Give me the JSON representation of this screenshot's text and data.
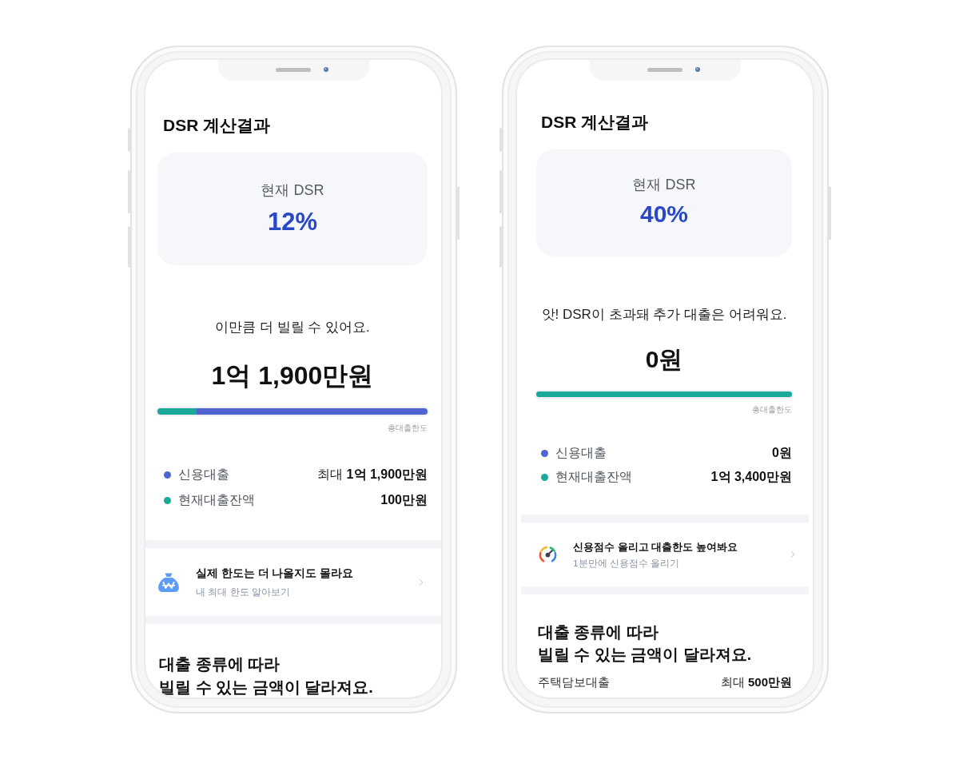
{
  "phones": [
    {
      "title": "DSR 계산결과",
      "dsr": {
        "label": "현재 DSR",
        "value": "12%"
      },
      "message": "이만큼 더 빌릴 수 있어요.",
      "amount": "1억 1,900만원",
      "bar": {
        "segments": [
          {
            "color": "#1aa89b",
            "level": 0.145
          },
          {
            "color": "#4f63d3",
            "level": 0.855
          }
        ],
        "caption": "총대출한도"
      },
      "legend": [
        {
          "label": "신용대출",
          "color": "#4f63d3",
          "prefix": "최대",
          "value": "1억 1,900만원"
        },
        {
          "label": "현재대출잔액",
          "color": "#1aa89b",
          "value": "100만원"
        }
      ],
      "promo": {
        "kind": "limit",
        "title": "실제 한도는 더 나올지도 몰라요",
        "subtitle": "내 최대 한도 알아보기"
      },
      "section": {
        "heading": "대출 종류에 따라\n빌릴 수 있는 금액이 달라져요."
      }
    },
    {
      "title": "DSR 계산결과",
      "dsr": {
        "label": "현재 DSR",
        "value": "40%"
      },
      "message": "앗! DSR이 초과돼 추가 대출은 어려워요.",
      "amount": "0원",
      "bar": {
        "segments": [
          {
            "color": "#1aa89b",
            "level": 1
          }
        ],
        "caption": "총대출한도"
      },
      "legend": [
        {
          "label": "신용대출",
          "color": "#4f63d3",
          "value": "0원"
        },
        {
          "label": "현재대출잔액",
          "color": "#1aa89b",
          "value": "1억 3,400만원"
        }
      ],
      "promo": {
        "kind": "credit_score",
        "title": "신용점수 올리고 대출한도 높여봐요",
        "subtitle": "1분만에 신용점수 올리기"
      },
      "section": {
        "heading": "대출 종류에 따라\n빌릴 수 있는 금액이 달라져요.",
        "rows": [
          {
            "label": "주택담보대출",
            "prefix": "최대",
            "value": "500만원"
          }
        ]
      }
    }
  ]
}
